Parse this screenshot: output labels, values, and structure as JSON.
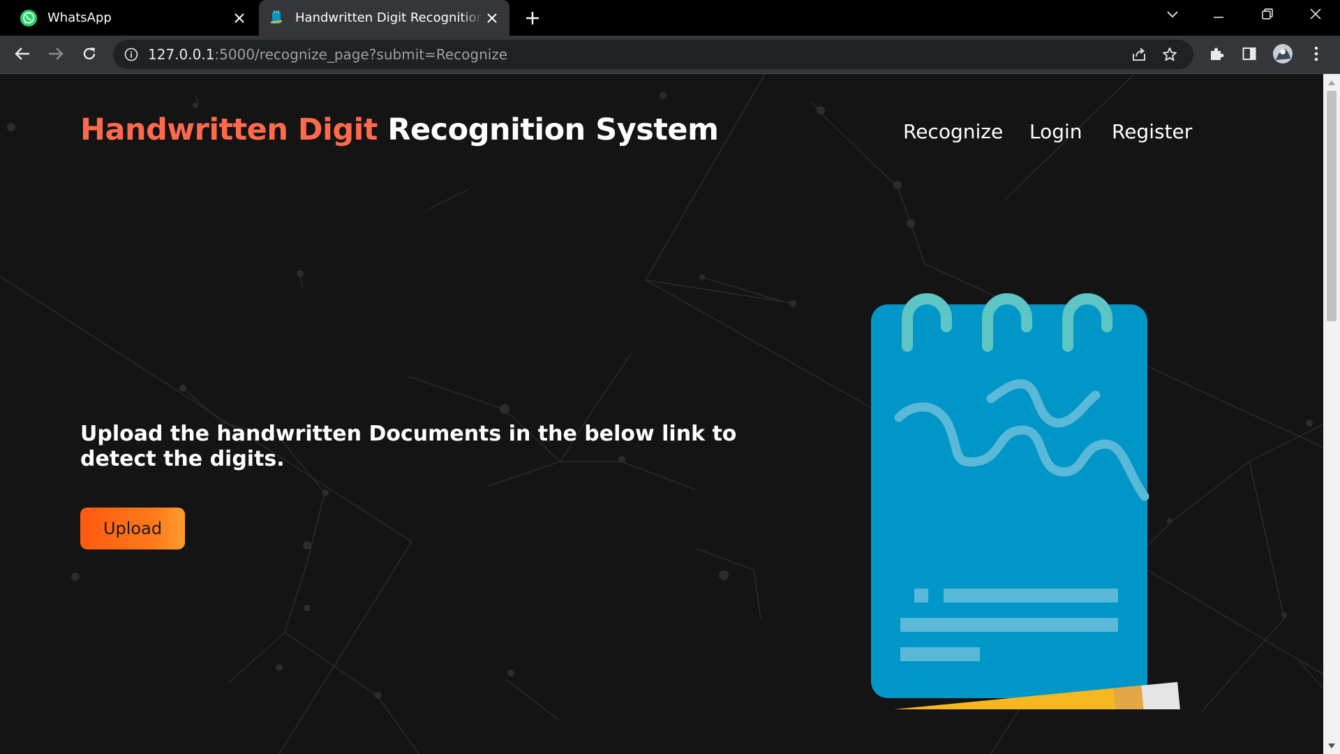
{
  "browser": {
    "tabs": [
      {
        "title": "WhatsApp",
        "favicon": "whatsapp-icon",
        "active": false
      },
      {
        "title": "Handwritten Digit Recognition System",
        "favicon": "notebook-favicon",
        "active": true
      }
    ],
    "address_bar": {
      "host": "127.0.0.1",
      "path": ":5000/recognize_page?submit=Recognize"
    }
  },
  "site": {
    "title_accent": "Handwritten Digit",
    "title_rest": " Recognition System",
    "nav": [
      "Recognize",
      "Login",
      "Register"
    ],
    "lead_text": "Upload the handwritten Documents in the below link to detect the digits.",
    "upload_label": "Upload"
  },
  "colors": {
    "page_bg": "#141414",
    "accent": "#ff6a4d",
    "button_gradient_start": "#ff5a10",
    "button_gradient_end": "#ff9d2f",
    "notebook_blue": "#0096c7",
    "ring_teal": "#5ec5c5",
    "pencil_yellow": "#f7b81f"
  }
}
